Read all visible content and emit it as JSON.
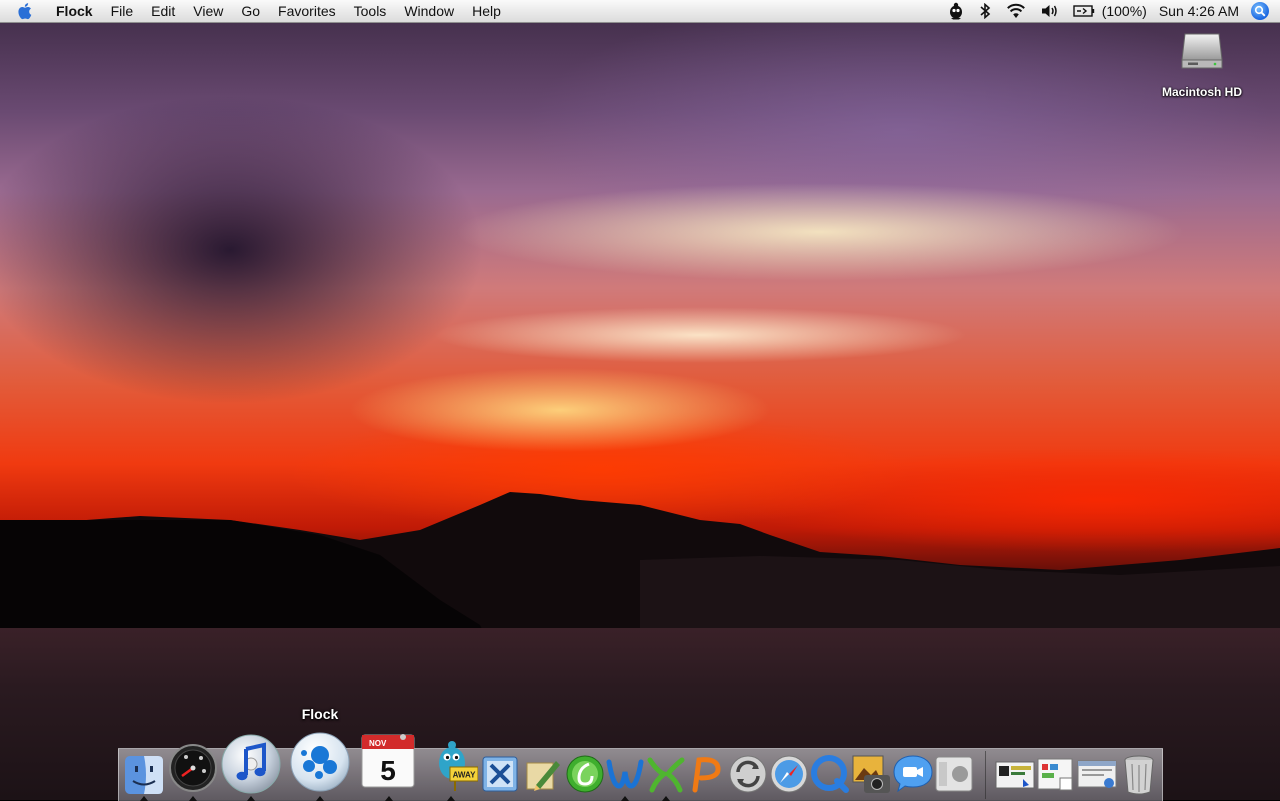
{
  "menubar": {
    "app_name": "Flock",
    "menus": [
      "File",
      "Edit",
      "View",
      "Go",
      "Favorites",
      "Tools",
      "Window",
      "Help"
    ],
    "battery": "(100%)",
    "clock": "Sun 4:26 AM",
    "status_icons": [
      "adium-icon",
      "bluetooth-icon",
      "wifi-icon",
      "volume-icon",
      "battery-icon",
      "spotlight-icon"
    ]
  },
  "desktop": {
    "drive_label": "Macintosh HD"
  },
  "dock": {
    "tooltip": "Flock",
    "calendar_month": "NOV",
    "calendar_day": "5",
    "away_sign": "AWAY",
    "apps": [
      "finder",
      "dashboard",
      "itunes",
      "flock",
      "ical",
      "adium",
      "x11-tool",
      "pen-tool",
      "dreamweaver",
      "contribute",
      "flash",
      "fireworks",
      "sync",
      "safari",
      "quicktime",
      "iphoto",
      "ichat",
      "system-profiler",
      "document-1",
      "document-2",
      "document-3",
      "trash"
    ]
  },
  "colors": {
    "menubar_top": "#fafafa",
    "menubar_bottom": "#dcdcdc",
    "sunset_red": "#f03a10",
    "spotlight_blue": "#1a66e0"
  }
}
